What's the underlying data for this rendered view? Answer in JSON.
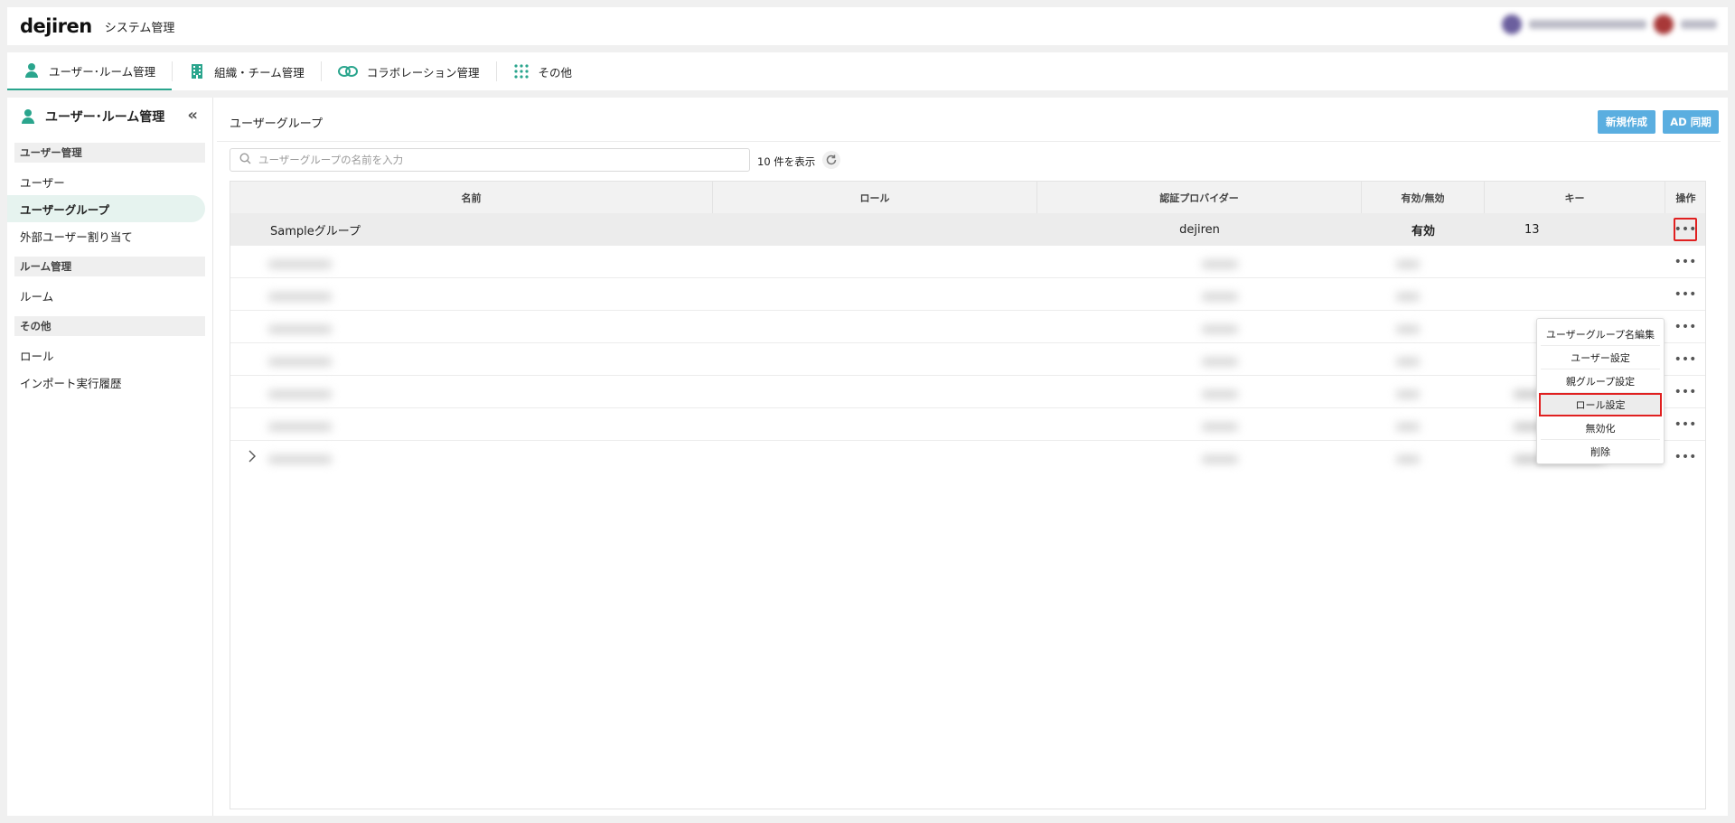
{
  "header": {
    "logo": "dejiren",
    "system_title": "システム管理"
  },
  "tabs": [
    {
      "label": "ユーザー･ルーム管理",
      "icon": "user-icon",
      "active": true
    },
    {
      "label": "組織・チーム管理",
      "icon": "building-icon"
    },
    {
      "label": "コラボレーション管理",
      "icon": "link-icon"
    },
    {
      "label": "その他",
      "icon": "grid-icon"
    }
  ],
  "sidebar": {
    "title": "ユーザー･ルーム管理",
    "sections": [
      {
        "label": "ユーザー管理",
        "items": [
          "ユーザー",
          "ユーザーグループ",
          "外部ユーザー割り当て"
        ]
      },
      {
        "label": "ルーム管理",
        "items": [
          "ルーム"
        ]
      },
      {
        "label": "その他",
        "items": [
          "ロール",
          "インポート実行履歴"
        ]
      }
    ],
    "active_item": "ユーザーグループ"
  },
  "content": {
    "title": "ユーザーグループ",
    "new_button": "新規作成",
    "ad_sync_button": "AD 同期",
    "search_placeholder": "ユーザーグループの名前を入力",
    "count_label": "10 件を表示"
  },
  "table": {
    "columns": [
      "名前",
      "ロール",
      "認証プロバイダー",
      "有効/無効",
      "キー",
      "操作"
    ],
    "first_row": {
      "name": "Sampleグループ",
      "role": "",
      "provider": "dejiren",
      "status": "有効",
      "key": "13"
    },
    "action_label": "•••"
  },
  "context_menu": {
    "items": [
      "ユーザーグループ名編集",
      "ユーザー設定",
      "親グループ設定",
      "ロール設定",
      "無効化",
      "削除"
    ],
    "highlighted": "ロール設定"
  },
  "colors": {
    "accent": "#2aa58d",
    "button": "#5aaee0",
    "highlight": "#e02020"
  }
}
